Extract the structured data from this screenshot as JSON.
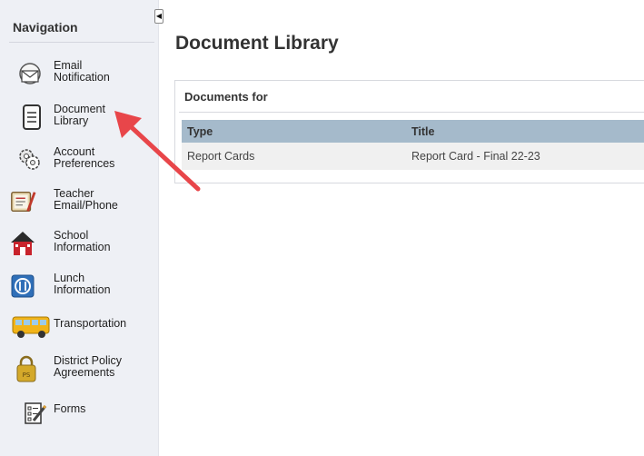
{
  "navigation": {
    "heading": "Navigation",
    "items": [
      {
        "line1": "Email",
        "line2": "Notification",
        "icon": "envelope-icon"
      },
      {
        "line1": "Document",
        "line2": "Library",
        "icon": "document-icon"
      },
      {
        "line1": "Account",
        "line2": "Preferences",
        "icon": "account-gears-icon"
      },
      {
        "line1": "Teacher",
        "line2": "Email/Phone",
        "icon": "teacher-notebook-icon"
      },
      {
        "line1": "School",
        "line2": "Information",
        "icon": "schoolhouse-icon"
      },
      {
        "line1": "Lunch",
        "line2": "Information",
        "icon": "lunch-icon"
      },
      {
        "line1": "Transportation",
        "line2": "",
        "icon": "school-bus-icon"
      },
      {
        "line1": "District Policy",
        "line2": "Agreements",
        "icon": "policy-lock-icon"
      },
      {
        "line1": "Forms",
        "line2": "",
        "icon": "forms-pencil-icon"
      }
    ]
  },
  "main": {
    "title": "Document Library",
    "panel_header": "Documents for",
    "table": {
      "columns": [
        "Type",
        "Title"
      ],
      "rows": [
        [
          "Report Cards",
          "Report Card - Final 22-23"
        ]
      ]
    }
  },
  "colors": {
    "sidebar_bg": "#eef0f5",
    "table_header_bg": "#a5bacb",
    "row_bg": "#f0f0f0",
    "arrow": "#e8464a"
  }
}
